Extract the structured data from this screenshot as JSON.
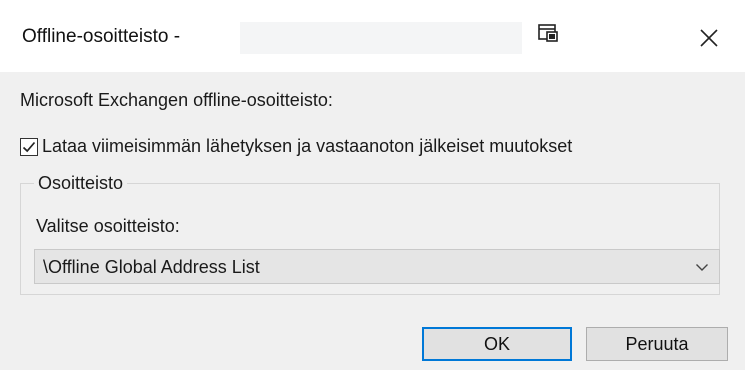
{
  "dialog": {
    "title": "Offline-osoitteisto -",
    "icons": {
      "titlebar": "window-pin-icon",
      "close": "close-icon"
    }
  },
  "content": {
    "exchange_label": "Microsoft Exchangen offline-osoitteisto:",
    "checkbox": {
      "label": "Lataa viimeisimmän lähetyksen ja vastaanoton jälkeiset muutokset",
      "checked": true
    },
    "group": {
      "legend": "Osoitteisto",
      "select_label": "Valitse osoitteisto:",
      "select_value": "\\Offline Global Address List"
    }
  },
  "buttons": {
    "ok": "OK",
    "cancel": "Peruuta"
  },
  "colors": {
    "accent": "#0078d7",
    "background": "#f0f0f0"
  }
}
